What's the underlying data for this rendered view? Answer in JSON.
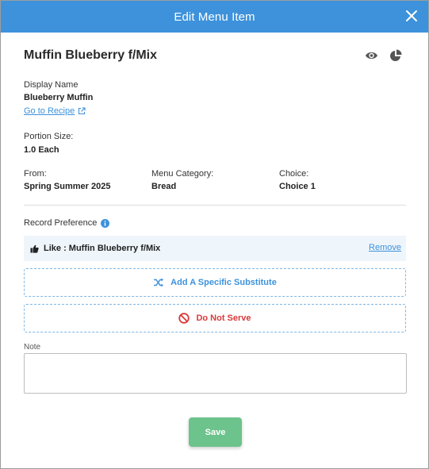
{
  "dialog": {
    "title": "Edit Menu Item"
  },
  "item": {
    "name": "Muffin Blueberry f/Mix",
    "display_name_label": "Display Name",
    "display_name": "Blueberry Muffin",
    "recipe_link": "Go to Recipe",
    "portion_label": "Portion Size:",
    "portion": "1.0 Each",
    "from_label": "From:",
    "from": "Spring Summer 2025",
    "category_label": "Menu Category:",
    "category": "Bread",
    "choice_label": "Choice:",
    "choice": "Choice 1"
  },
  "preference": {
    "label": "Record Preference",
    "current": "Like : Muffin Blueberry f/Mix",
    "remove": "Remove",
    "add_substitute": "Add A Specific Substitute",
    "do_not_serve": "Do Not Serve"
  },
  "note": {
    "label": "Note",
    "value": ""
  },
  "actions": {
    "save": "Save"
  },
  "colors": {
    "header": "#3d92db",
    "accent": "#3d92db",
    "danger": "#d93a3a",
    "save": "#6cc38b",
    "pref_bg": "#eef5fb"
  },
  "icons": [
    "close-icon",
    "eye-icon",
    "pie-chart-icon",
    "external-link-icon",
    "info-icon",
    "thumbs-up-icon",
    "shuffle-icon",
    "prohibited-icon"
  ]
}
